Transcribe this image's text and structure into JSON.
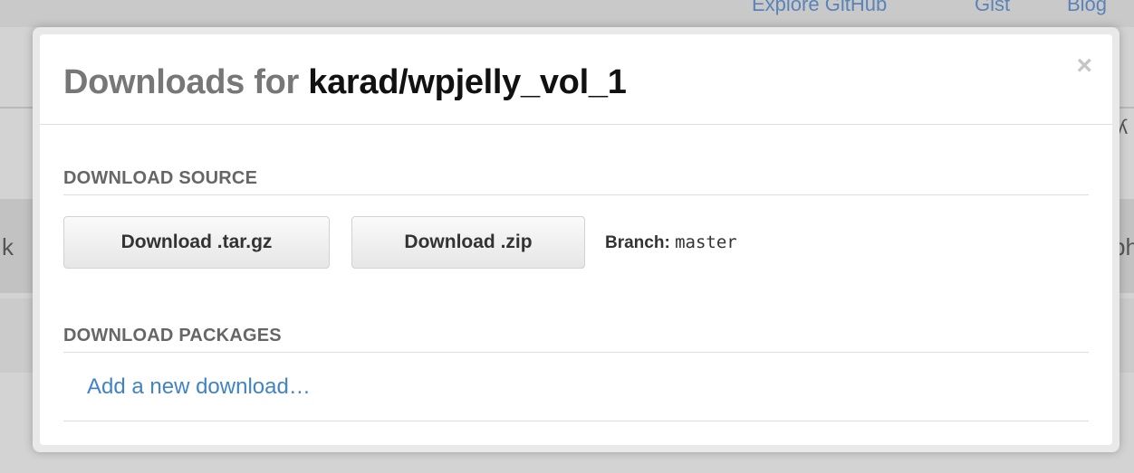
{
  "background": {
    "nav_links": [
      "Explore GitHub",
      "Gist",
      "Blog"
    ],
    "edge_left_glyph": "k",
    "edge_right_glyph": "ph",
    "edge_top_right_glyph": "ʎ"
  },
  "modal": {
    "title_prefix": "Downloads for ",
    "title_repo": "karad/wpjelly_vol_1",
    "close_glyph": "×",
    "source": {
      "heading": "DOWNLOAD SOURCE",
      "tar_button": "Download .tar.gz",
      "zip_button": "Download .zip",
      "branch_label": "Branch:",
      "branch_value": "master"
    },
    "packages": {
      "heading": "DOWNLOAD PACKAGES",
      "add_link": "Add a new download…"
    }
  },
  "colors": {
    "link": "#4183c4",
    "title_muted": "#777777",
    "title_strong": "#111111",
    "overlay": "#d3d3d3"
  },
  "icons": {
    "close": "close-icon"
  }
}
